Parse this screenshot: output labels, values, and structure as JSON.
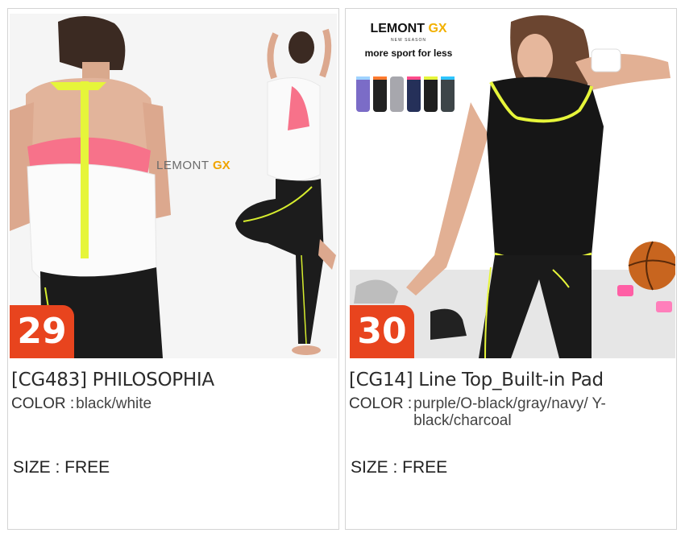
{
  "products": [
    {
      "number": "29",
      "title": "[CG483] PHILOSOPHIA",
      "color_label": "COLOR :",
      "color_value": "black/white",
      "size_label": "SIZE : FREE",
      "logo_a": "LEMONT",
      "logo_b": "GX"
    },
    {
      "number": "30",
      "title": "[CG14] Line Top_Built-in Pad",
      "color_label": "COLOR :",
      "color_value": "purple/O-black/gray/navy/ Y-black/charcoal",
      "size_label": "SIZE : FREE",
      "promo": {
        "brand_a": "LEMONT ",
        "brand_b": "GX",
        "season": "NEW SEASON",
        "tagline": "more sport for less"
      }
    }
  ],
  "colors": {
    "badge": "#e8441e",
    "accent_yellow": "#e6f53a",
    "pink": "#f7728a"
  },
  "swatches": [
    "purple",
    "O-black",
    "gray",
    "navy",
    "Y-black",
    "charcoal"
  ]
}
